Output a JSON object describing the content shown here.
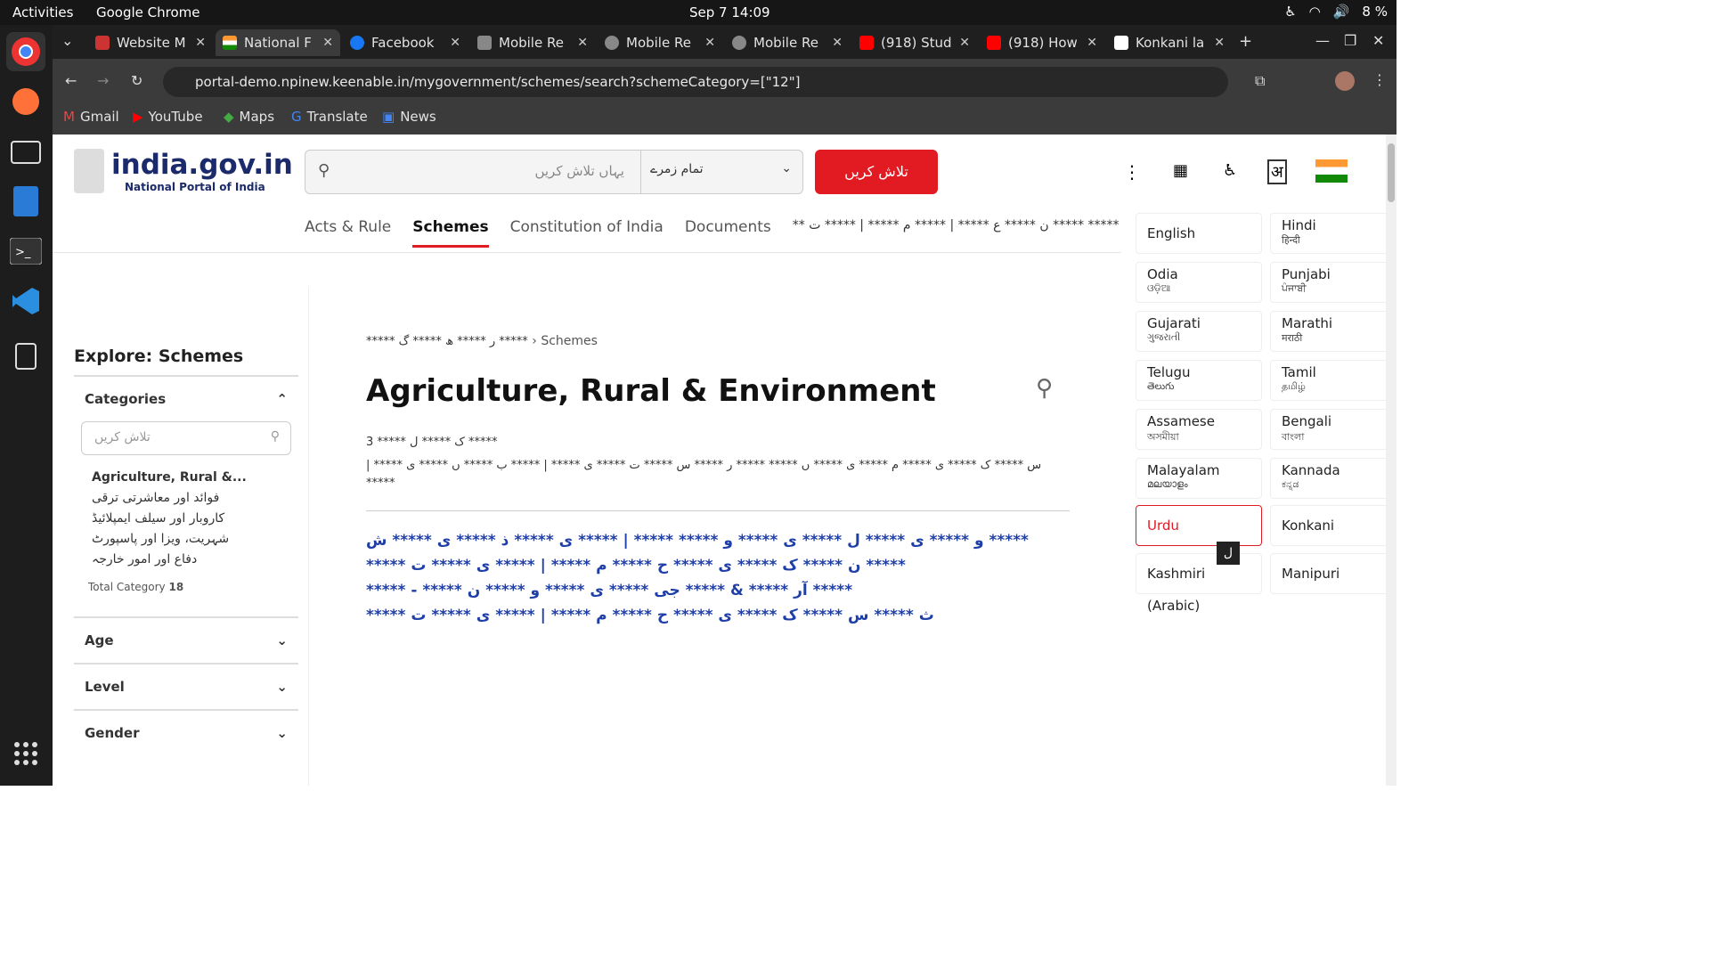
{
  "system": {
    "activities": "Activities",
    "app": "Google Chrome",
    "clock": "Sep 7  14:09",
    "battery": "8 %"
  },
  "tabs": [
    {
      "label": "Website M"
    },
    {
      "label": "National F"
    },
    {
      "label": "Facebook"
    },
    {
      "label": "Mobile Re"
    },
    {
      "label": "Mobile Re"
    },
    {
      "label": "Mobile Re"
    },
    {
      "label": "(918) Stud"
    },
    {
      "label": "(918) How"
    },
    {
      "label": "Konkani la"
    }
  ],
  "url": "portal-demo.npinew.keenable.in/mygovernment/schemes/search?schemeCategory=[\"12\"]",
  "bookmarks": [
    "Gmail",
    "YouTube",
    "Maps",
    "Translate",
    "News"
  ],
  "site": {
    "logo": "india.gov.in",
    "logo_sub": "National Portal of India",
    "search_placeholder": "یہاں تلاش کریں",
    "category": "تمام زمرے",
    "search_button": "تلاش کریں"
  },
  "nav": [
    "Acts & Rule",
    "Schemes",
    "Constitution of India",
    "Documents"
  ],
  "nav_extra": "** ن ***** ع ***** | ***** م ***** | ***** ت ***** *****",
  "sidebar": {
    "title": "Explore: Schemes",
    "categories": "Categories",
    "filter_placeholder": "تلاش کریں",
    "items": [
      "Agriculture, Rural &...",
      "فوائد اور معاشرتی ترقی",
      "کاروبار اور سیلف ایمپلائیڈ",
      "شہریت، ویزا اور پاسپورٹ",
      "دفاع اور امور خارجہ"
    ],
    "total_label": "Total Category",
    "total": "18",
    "filters": [
      "Age",
      "Level",
      "Gender"
    ]
  },
  "content": {
    "breadcrumb": "***** ر ***** ھ ***** گ *****",
    "crumb_current": "Schemes",
    "title": "Agriculture, Rural & Environment",
    "meta1": "3 ***** ک ***** ل *****",
    "meta2": "| ***** س ***** ک ***** ی ***** م ***** ی ***** ں ***** ***** ر ***** س ***** ت ***** ی ***** | ***** ب ***** ں ***** ی *****",
    "link_lines": [
      "و ***** ی ***** ل ***** ی ***** و ***** ***** | ***** ی ***** ذ ***** ی ***** ش *****",
      "***** ن ***** ک ***** ی ***** ح ***** م ***** | ***** ی ***** ت *****",
      "***** - ***** آر ***** & ***** جی ***** ی ***** و ***** ن *****",
      "***** ث ***** س ***** ک ***** ی ***** ح ***** م ***** | ***** ی ***** ت"
    ]
  },
  "languages": [
    {
      "name": "English",
      "native": ""
    },
    {
      "name": "Hindi",
      "native": "हिन्दी"
    },
    {
      "name": "Odia",
      "native": "ଓଡ଼ିଆ"
    },
    {
      "name": "Punjabi",
      "native": "ਪੰਜਾਬੀ"
    },
    {
      "name": "Gujarati",
      "native": "ગુજરાતી"
    },
    {
      "name": "Marathi",
      "native": "मराठी"
    },
    {
      "name": "Telugu",
      "native": "తెలుగు"
    },
    {
      "name": "Tamil",
      "native": "தமிழ்"
    },
    {
      "name": "Assamese",
      "native": "অসমীয়া"
    },
    {
      "name": "Bengali",
      "native": "বাংলা"
    },
    {
      "name": "Malayalam",
      "native": "മലയാളം"
    },
    {
      "name": "Kannada",
      "native": "ಕನ್ನಡ"
    },
    {
      "name": "Urdu",
      "native": ""
    },
    {
      "name": "Konkani",
      "native": ""
    },
    {
      "name": "Kashmiri (Arabic)",
      "native": ""
    },
    {
      "name": "Manipuri",
      "native": ""
    }
  ],
  "tooltip": "ل",
  "colors": {
    "accent": "#e21b23",
    "link": "#1f3fa8"
  }
}
